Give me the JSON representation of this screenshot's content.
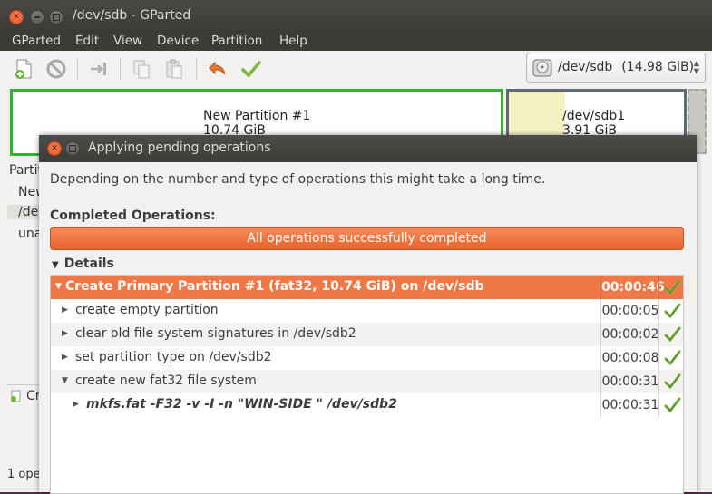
{
  "main_window": {
    "title": "/dev/sdb - GParted",
    "menu": [
      "GParted",
      "Edit",
      "View",
      "Device",
      "Partition",
      "Help"
    ],
    "toolbar_icons": [
      "new-partition-icon",
      "delete-icon",
      "resize-move-icon",
      "copy-icon",
      "paste-icon",
      "undo-icon",
      "apply-icon"
    ],
    "device_selector": {
      "device": "/dev/sdb",
      "size": "(14.98 GiB)"
    },
    "partitions": [
      {
        "name": "New Partition #1",
        "size": "10.74 GiB",
        "border": "#2fb52f"
      },
      {
        "name": "/dev/sdb1",
        "size": "3.91 GiB",
        "border": "#5b6b7c"
      }
    ],
    "list_fragments": [
      "Partit",
      "New",
      "/dev",
      "una"
    ],
    "pending_fragment": "Cr",
    "status_fragment": "1 ope"
  },
  "dialog": {
    "title": "Applying pending operations",
    "description": "Depending on the number and type of operations this might take a long time.",
    "completed_label": "Completed Operations:",
    "progress": {
      "text": "All operations successfully completed",
      "fraction": 1.0,
      "color": "#e9622c"
    },
    "details_label": "Details",
    "operations": [
      {
        "name": "Create Primary Partition #1 (fat32, 10.74 GiB) on /dev/sdb",
        "time": "00:00:46",
        "status": "success",
        "expander": "down",
        "level": 0
      },
      {
        "name": "create empty partition",
        "time": "00:00:05",
        "status": "success",
        "expander": "right",
        "level": 1
      },
      {
        "name": "clear old file system signatures in /dev/sdb2",
        "time": "00:00:02",
        "status": "success",
        "expander": "right",
        "level": 1
      },
      {
        "name": "set partition type on /dev/sdb2",
        "time": "00:00:08",
        "status": "success",
        "expander": "right",
        "level": 1
      },
      {
        "name": "create new fat32 file system",
        "time": "00:00:31",
        "status": "success",
        "expander": "down",
        "level": 1
      },
      {
        "name": "mkfs.fat -F32 -v -I -n \"WIN-SIDE   \" /dev/sdb2",
        "time": "00:00:31",
        "status": "success",
        "expander": "right",
        "level": 2
      }
    ]
  }
}
